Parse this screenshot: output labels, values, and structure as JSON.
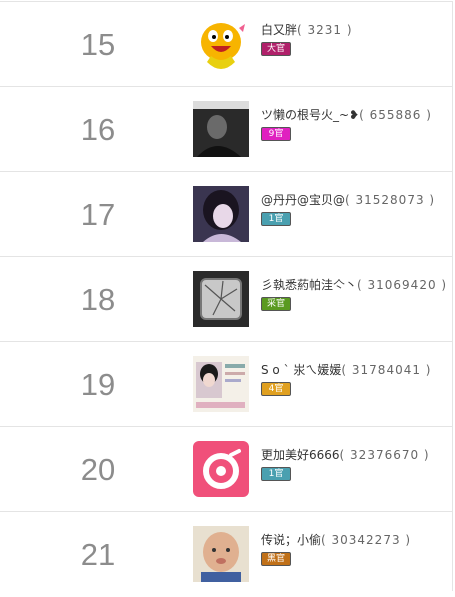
{
  "rows": [
    {
      "rank": "15",
      "name": "白又胖",
      "id_text": "( 3231 )",
      "badge": "大官",
      "badge_color": "#b0206a",
      "avatar_icon": "qq-penguin-icon"
    },
    {
      "rank": "16",
      "name": "ツ懒の根号火_~❥",
      "id_text": "( 655886 )",
      "badge": "9官",
      "badge_color": "#e020c0",
      "avatar_icon": "dark-photo-icon"
    },
    {
      "rank": "17",
      "name": "@丹丹@宝贝@",
      "id_text": "( 31528073 )",
      "badge": "1官",
      "badge_color": "#4aa0b0",
      "avatar_icon": "girl-photo-icon"
    },
    {
      "rank": "18",
      "name": "彡執悉葯帕洼亽丶",
      "id_text": "( 31069420 )",
      "badge": "采官",
      "badge_color": "#5a9a20",
      "avatar_icon": "cracked-glass-icon"
    },
    {
      "rank": "19",
      "name": "S o ` 汖ㄟ媛媛",
      "id_text": "( 31784041 )",
      "badge": "4官",
      "badge_color": "#e0a020",
      "avatar_icon": "photo-card-icon"
    },
    {
      "rank": "20",
      "name": "更加美好6666",
      "id_text": "( 32376670 )",
      "badge": "1官",
      "badge_color": "#4aa0b0",
      "avatar_icon": "pink-ring-app-icon"
    },
    {
      "rank": "21",
      "name": "传说；小偷",
      "id_text": "( 30342273 )",
      "badge": "黑官",
      "badge_color": "#c07018",
      "avatar_icon": "baby-photo-icon"
    }
  ]
}
